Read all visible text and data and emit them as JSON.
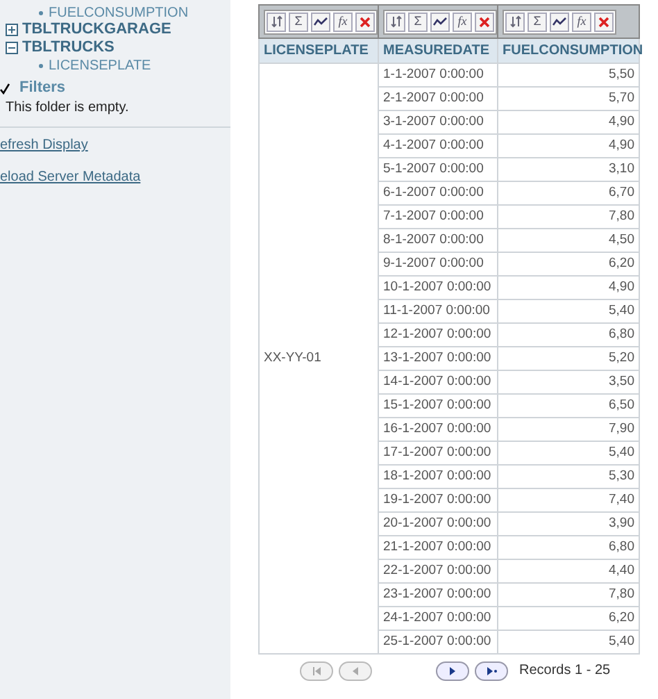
{
  "sidebar": {
    "tree": [
      {
        "label": "FUELCONSUMPTION",
        "kind": "leaf"
      },
      {
        "label": "TBLTRUCKGARAGE",
        "kind": "table",
        "expanded": false
      },
      {
        "label": "TBLTRUCKS",
        "kind": "table",
        "expanded": true,
        "children": [
          {
            "label": "LICENSEPLATE",
            "kind": "leaf"
          }
        ]
      }
    ],
    "filters": {
      "label": "Filters",
      "checked": true,
      "note": "This folder is empty."
    },
    "links": [
      "efresh Display",
      "eload Server Metadata"
    ]
  },
  "table": {
    "toolbars": [
      [
        {
          "kind": "sort"
        },
        {
          "kind": "sum",
          "label": "Σ"
        },
        {
          "kind": "chart"
        },
        {
          "kind": "formula",
          "label": "fx"
        },
        {
          "kind": "delete"
        }
      ],
      [
        {
          "kind": "sort"
        },
        {
          "kind": "sum",
          "label": "Σ"
        },
        {
          "kind": "chart"
        },
        {
          "kind": "formula",
          "label": "fx"
        },
        {
          "kind": "delete"
        }
      ],
      [
        {
          "kind": "sort"
        },
        {
          "kind": "sum",
          "label": "Σ"
        },
        {
          "kind": "chart"
        },
        {
          "kind": "formula",
          "label": "fx"
        },
        {
          "kind": "delete"
        }
      ]
    ],
    "columns": [
      "LICENSEPLATE",
      "MEASUREDATE",
      "FUELCONSUMPTION"
    ],
    "rows": [
      [
        "",
        "1-1-2007 0:00:00",
        "5,50"
      ],
      [
        "",
        "2-1-2007 0:00:00",
        "5,70"
      ],
      [
        "",
        "3-1-2007 0:00:00",
        "4,90"
      ],
      [
        "",
        "4-1-2007 0:00:00",
        "4,90"
      ],
      [
        "",
        "5-1-2007 0:00:00",
        "3,10"
      ],
      [
        "",
        "6-1-2007 0:00:00",
        "6,70"
      ],
      [
        "",
        "7-1-2007 0:00:00",
        "7,80"
      ],
      [
        "",
        "8-1-2007 0:00:00",
        "4,50"
      ],
      [
        "",
        "9-1-2007 0:00:00",
        "6,20"
      ],
      [
        "",
        "10-1-2007 0:00:00",
        "4,90"
      ],
      [
        "",
        "11-1-2007 0:00:00",
        "5,40"
      ],
      [
        "",
        "12-1-2007 0:00:00",
        "6,80"
      ],
      [
        "XX-YY-01",
        "13-1-2007 0:00:00",
        "5,20"
      ],
      [
        "",
        "14-1-2007 0:00:00",
        "3,50"
      ],
      [
        "",
        "15-1-2007 0:00:00",
        "6,50"
      ],
      [
        "",
        "16-1-2007 0:00:00",
        "7,90"
      ],
      [
        "",
        "17-1-2007 0:00:00",
        "5,40"
      ],
      [
        "",
        "18-1-2007 0:00:00",
        "5,30"
      ],
      [
        "",
        "19-1-2007 0:00:00",
        "7,40"
      ],
      [
        "",
        "20-1-2007 0:00:00",
        "3,90"
      ],
      [
        "",
        "21-1-2007 0:00:00",
        "6,80"
      ],
      [
        "",
        "22-1-2007 0:00:00",
        "4,40"
      ],
      [
        "",
        "23-1-2007 0:00:00",
        "7,80"
      ],
      [
        "",
        "24-1-2007 0:00:00",
        "6,20"
      ],
      [
        "",
        "25-1-2007 0:00:00",
        "5,40"
      ]
    ]
  },
  "pager": {
    "buttons": [
      {
        "kind": "first",
        "disabled": true
      },
      {
        "kind": "prev",
        "disabled": true
      },
      {
        "kind": "next",
        "disabled": false
      },
      {
        "kind": "last",
        "disabled": false
      }
    ],
    "records": "Records 1 - 25"
  }
}
